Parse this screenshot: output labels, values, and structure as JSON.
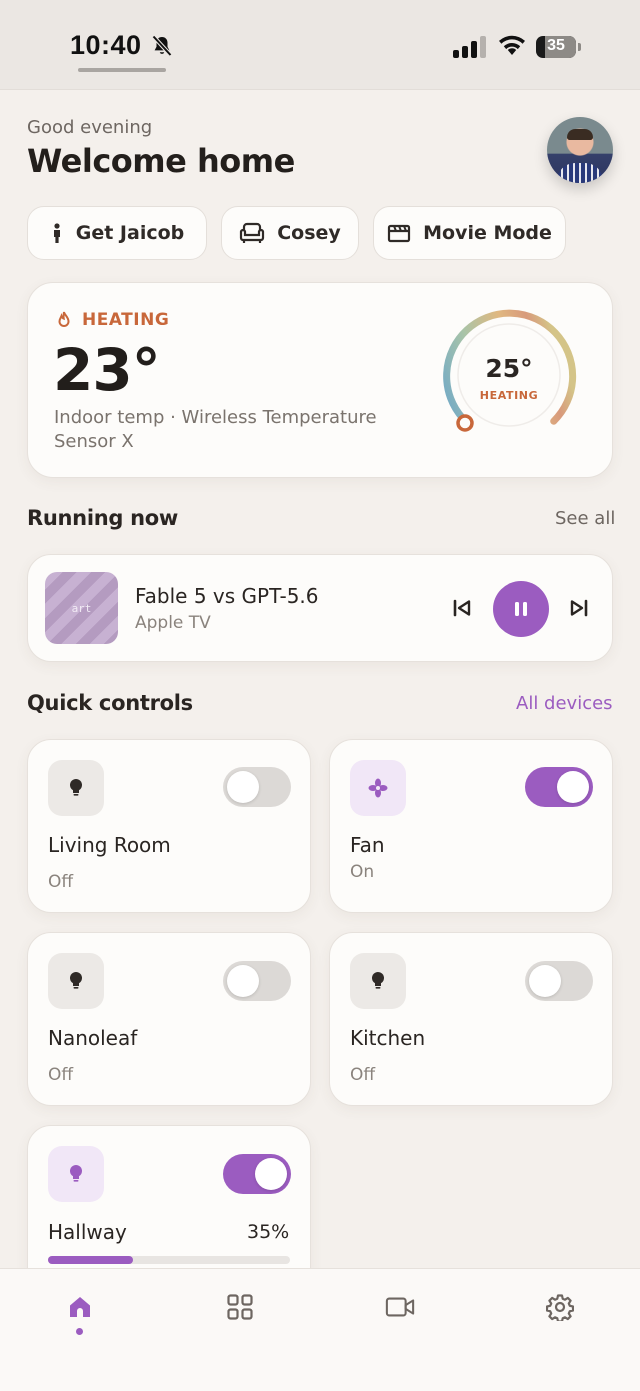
{
  "status_bar": {
    "time": "10:40",
    "battery": "35"
  },
  "header": {
    "greeting": "Good evening",
    "title": "Welcome home"
  },
  "scenes": [
    {
      "label": "Get Jaicob",
      "icon": "person-icon"
    },
    {
      "label": "Cosey",
      "icon": "sofa-icon"
    },
    {
      "label": "Movie Mode",
      "icon": "clapperboard-icon"
    }
  ],
  "thermostat": {
    "mode_label": "HEATING",
    "current_temp": "23°",
    "source": "Indoor temp · Wireless Temperature Sensor X",
    "target_temp": "25°",
    "target_label": "HEATING",
    "accent_color": "#c8673a"
  },
  "running_now": {
    "title": "Running now",
    "see_all": "See all",
    "media": {
      "art_placeholder": "art",
      "track": "Fable 5 vs GPT-5.6",
      "source": "Apple TV",
      "state": "playing"
    }
  },
  "quick_controls": {
    "title": "Quick controls",
    "all_devices": "All devices",
    "devices": [
      {
        "name": "Living Room",
        "state": "Off",
        "on": false,
        "icon": "bulb-icon"
      },
      {
        "name": "Fan",
        "state": "On",
        "on": true,
        "icon": "fan-icon"
      },
      {
        "name": "Nanoleaf",
        "state": "Off",
        "on": false,
        "icon": "bulb-icon"
      },
      {
        "name": "Kitchen",
        "state": "Off",
        "on": false,
        "icon": "bulb-icon"
      },
      {
        "name": "Hallway",
        "brightness_label": "35%",
        "brightness": 0.35,
        "on": true,
        "icon": "bulb-icon"
      }
    ]
  },
  "bottom_nav": {
    "items": [
      {
        "icon": "home-icon",
        "active": true
      },
      {
        "icon": "grid-icon",
        "active": false
      },
      {
        "icon": "camera-icon",
        "active": false
      },
      {
        "icon": "settings-icon",
        "active": false
      }
    ]
  },
  "colors": {
    "accent": "#9b5cc0",
    "heating": "#c8673a",
    "background": "#f4f0ec"
  }
}
